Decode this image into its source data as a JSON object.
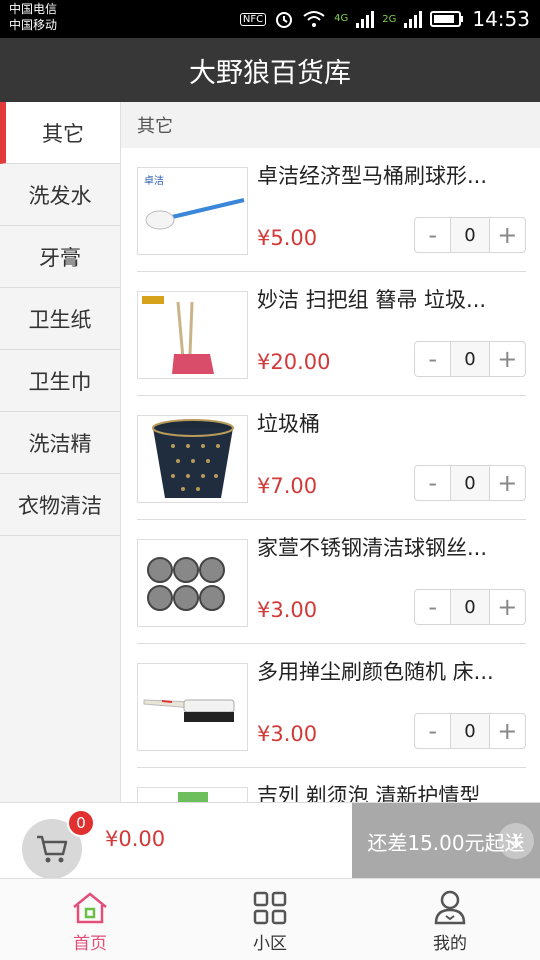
{
  "status": {
    "carrier1": "中国电信",
    "carrier2": "中国移动",
    "nfc": "NFC",
    "net_4g": "4G",
    "net_2g": "2G",
    "time": "14:53"
  },
  "header": {
    "title": "大野狼百货库"
  },
  "sidebar": {
    "items": [
      {
        "label": "其它"
      },
      {
        "label": "洗发水"
      },
      {
        "label": "牙膏"
      },
      {
        "label": "卫生纸"
      },
      {
        "label": "卫生巾"
      },
      {
        "label": "洗洁精"
      },
      {
        "label": "衣物清洁"
      }
    ]
  },
  "main": {
    "section_title": "其它",
    "products": [
      {
        "name": "卓洁经济型马桶刷球形...",
        "price": "¥5.00",
        "qty": "0"
      },
      {
        "name": "妙洁 扫把组 簮帚 垃圾...",
        "price": "¥20.00",
        "qty": "0"
      },
      {
        "name": "垃圾桶",
        "price": "¥7.00",
        "qty": "0"
      },
      {
        "name": "家萱不锈钢清洁球钢丝...",
        "price": "¥3.00",
        "qty": "0"
      },
      {
        "name": "多用掸尘刷颜色随机 床...",
        "price": "¥3.00",
        "qty": "0"
      },
      {
        "name": "吉列 剃须泡 清新护情型",
        "price": "",
        "qty": ""
      }
    ],
    "stepper": {
      "minus": "-",
      "plus": "+"
    }
  },
  "cart": {
    "badge": "0",
    "total": "¥0.00",
    "checkout_label": "还差15.00元起送"
  },
  "tabs": [
    {
      "label": "首页",
      "icon": "home-icon"
    },
    {
      "label": "小区",
      "icon": "grid-icon"
    },
    {
      "label": "我的",
      "icon": "profile-icon"
    }
  ],
  "colors": {
    "accent": "#e23b3b",
    "price": "#d23a3a",
    "tab_active": "#e2507a",
    "header_bg": "#373737"
  }
}
